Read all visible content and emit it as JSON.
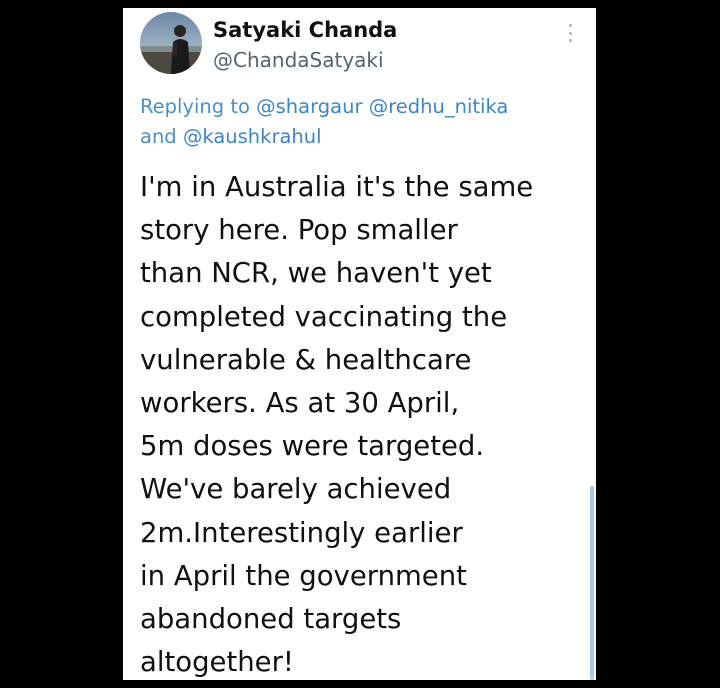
{
  "tweet": {
    "author_name": "Satyaki Chanda",
    "author_handle": "@ChandaSatyaki",
    "replying_prefix": "Replying to ",
    "mentions": [
      "@shargaur",
      "@redhu_nitika",
      "@kaushkrahul"
    ],
    "mention_joiner": "and ",
    "body_lines": [
      "I'm in Australia it's the same",
      "story here. Pop smaller",
      "than NCR, we haven't yet",
      "completed vaccinating the",
      "vulnerable & healthcare",
      "workers. As at 30 April,",
      "5m doses were targeted.",
      "We've barely achieved",
      "2m.Interestingly earlier",
      "in April the government",
      "abandoned targets",
      "altogether!"
    ]
  },
  "icons": {
    "avatar": "avatar-photo",
    "menu": "more-vertical-icon"
  },
  "colors": {
    "background": "#000000",
    "card": "#ffffff",
    "text": "#111111",
    "handle": "#536471",
    "mention": "#3b86c9",
    "scrollbar": "#a9c9ea"
  }
}
